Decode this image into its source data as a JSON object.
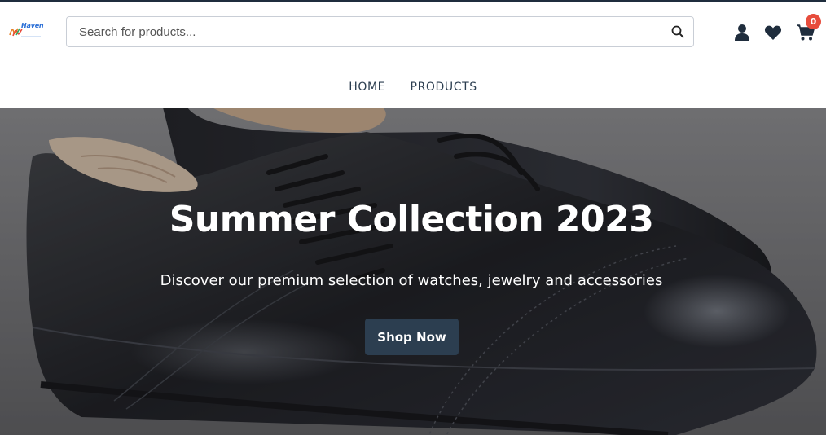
{
  "brand": {
    "logo_text": "Haven"
  },
  "search": {
    "placeholder": "Search for products..."
  },
  "header": {
    "cart_count": "0"
  },
  "nav": {
    "items": [
      {
        "label": "HOME"
      },
      {
        "label": "PRODUCTS"
      }
    ]
  },
  "hero": {
    "title": "Summer Collection 2023",
    "subtitle": "Discover our premium selection of watches, jewelry and accessories",
    "cta_label": "Shop Now"
  },
  "colors": {
    "primary": "#2c3e50",
    "badge": "#e74c3c",
    "background": "#ffffff"
  },
  "icons": [
    "search-icon",
    "user-icon",
    "heart-icon",
    "cart-icon"
  ]
}
